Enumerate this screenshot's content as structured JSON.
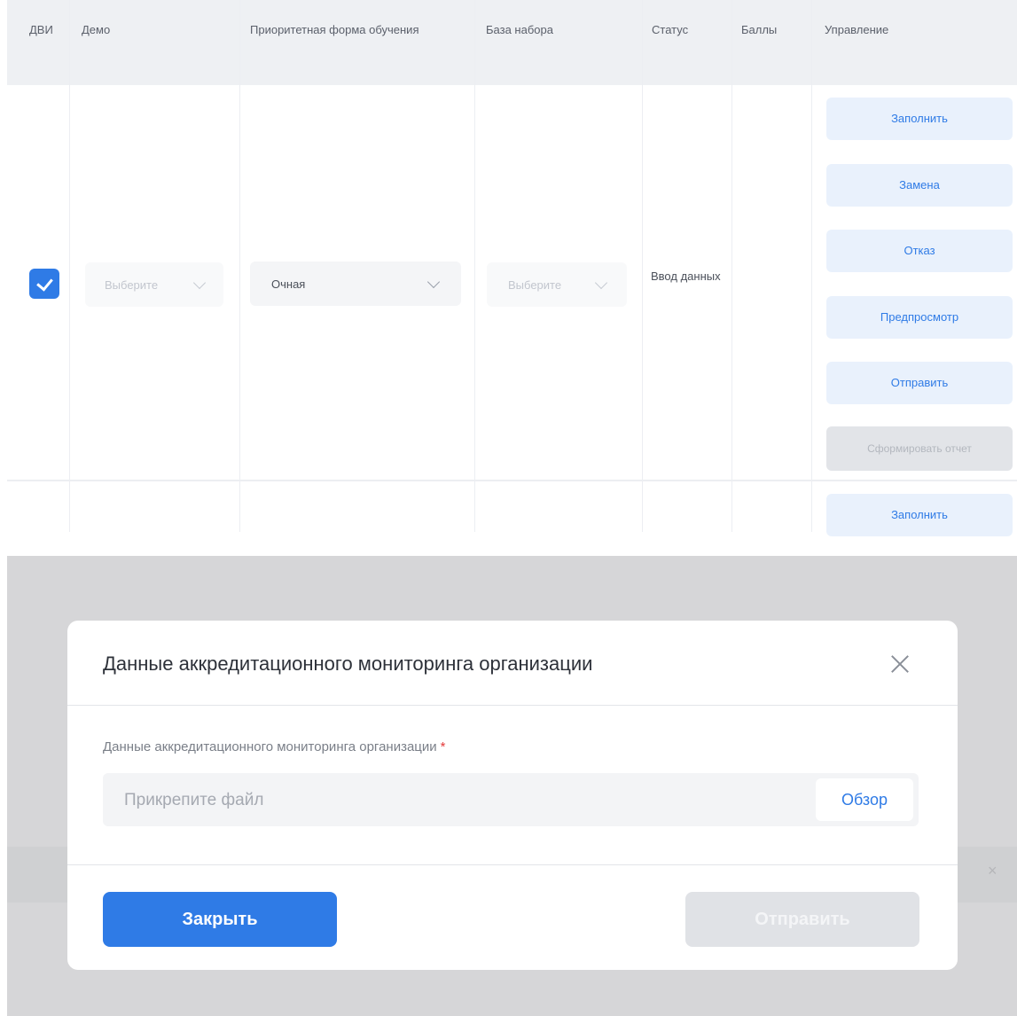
{
  "table": {
    "headers": {
      "dvi": "ДВИ",
      "demo": "Демо",
      "priority": "Приоритетная форма обучения",
      "base": "База набора",
      "status": "Статус",
      "score": "Баллы",
      "manage": "Управление"
    },
    "row": {
      "checked": true,
      "demo_select": "Выберите",
      "priority_select": "Очная",
      "base_select": "Выберите",
      "status": "Ввод данных",
      "actions": {
        "fill": "Заполнить",
        "replace": "Замена",
        "refuse": "Отказ",
        "preview": "Предпросмотр",
        "send": "Отправить",
        "report": "Сформировать отчет"
      }
    },
    "next_row_action": "Заполнить"
  },
  "overlay": {
    "close_glyph": "×"
  },
  "modal": {
    "title": "Данные аккредитационного мониторинга организации",
    "field_label": "Данные аккредитационного мониторинга организации",
    "required_mark": "*",
    "file_placeholder": "Прикрепите файл",
    "browse_label": "Обзор",
    "close_button": "Закрыть",
    "send_button": "Отправить"
  },
  "colors": {
    "accent": "#2f7be6",
    "action_bg": "#e9f1fc",
    "overlay": "#d6d6d8",
    "required": "#e43b3b"
  }
}
